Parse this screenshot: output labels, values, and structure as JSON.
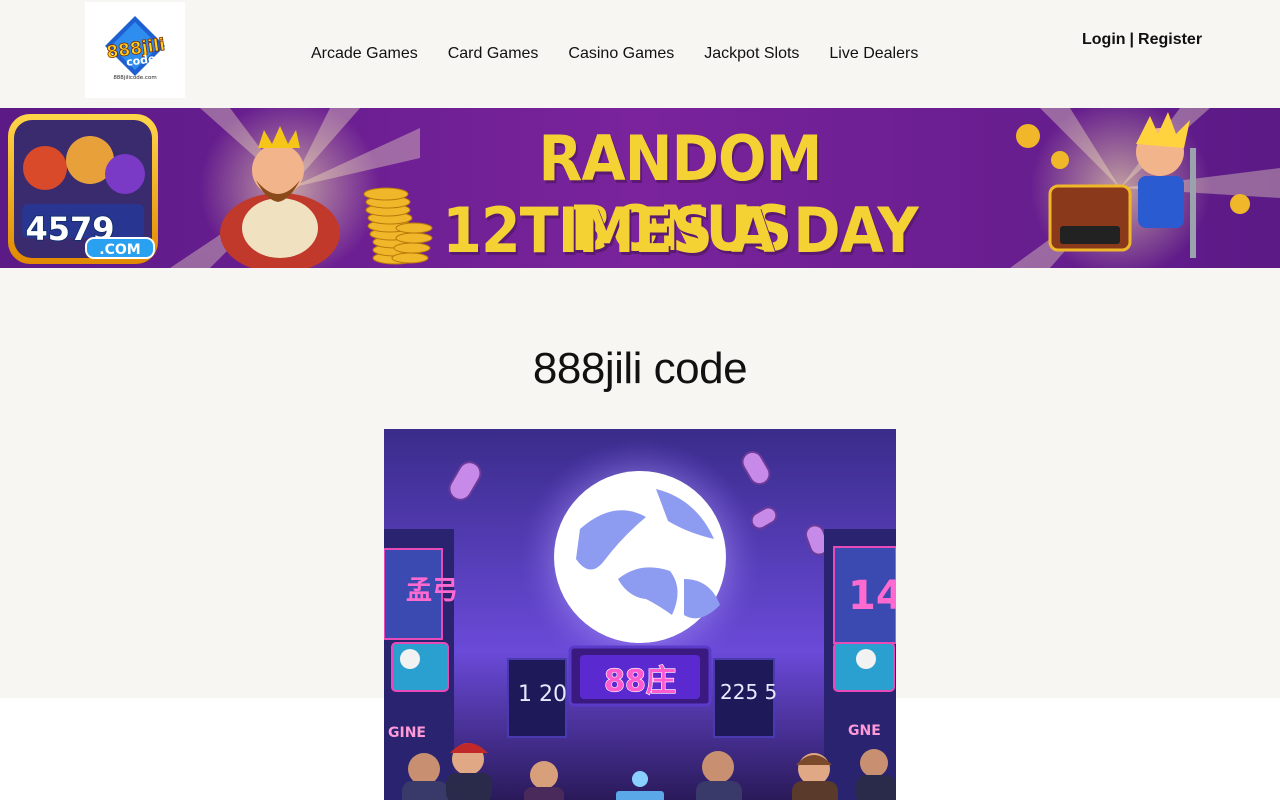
{
  "header": {
    "logo_text": "888jili code",
    "logo_subtext": "888jilicode.com",
    "nav": [
      {
        "label": "Arcade Games"
      },
      {
        "label": "Card Games"
      },
      {
        "label": "Casino Games"
      },
      {
        "label": "Jackpot Slots"
      },
      {
        "label": "Live Dealers"
      }
    ],
    "login_label": "Login",
    "separator": "|",
    "register_label": "Register"
  },
  "banner": {
    "line1": "RANDOM BONUS",
    "line2": "12TIMES A DAY",
    "site_badge": "4579",
    "site_badge_suffix": ".COM",
    "colors": {
      "background": "#6a1d8c",
      "text": "#f5d233"
    }
  },
  "hero": {
    "title": "888jili code",
    "image_sign": "88庄",
    "image_left_sign": "孟弓",
    "image_right_sign": "14",
    "image_screen_left": "1 20",
    "image_screen_right": "225 5",
    "image_left_label": "GINE",
    "image_right_label": "GNE"
  }
}
